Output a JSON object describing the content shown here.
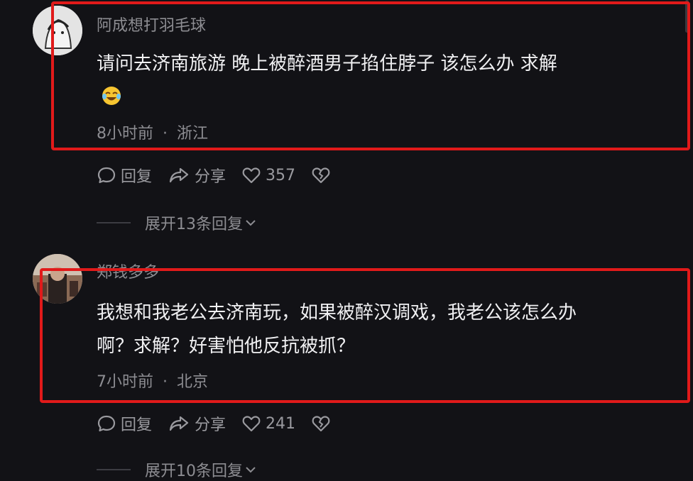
{
  "comments": [
    {
      "username": "阿成想打羽毛球",
      "text_line1": "请问去济南旅游 晚上被醉酒男子掐住脖子 该怎么办 求解",
      "emoji": "rolling-laugh-emoji",
      "time": "8小时前",
      "location": "浙江",
      "reply_label": "回复",
      "share_label": "分享",
      "likes": "357",
      "expand_label": "展开13条回复"
    },
    {
      "username": "郑钱多多",
      "text_line1": "我想和我老公去济南玩，如果被醉汉调戏，我老公该怎么办",
      "text_line2": "啊？求解？好害怕他反抗被抓？",
      "time": "7小时前",
      "location": "北京",
      "reply_label": "回复",
      "share_label": "分享",
      "likes": "241",
      "expand_label": "展开10条回复"
    }
  ],
  "separator": "·",
  "colors": {
    "background": "#121216",
    "highlight": "#e11a1a",
    "secondary_text": "#8d8d92"
  },
  "icons": [
    "comment-bubble-icon",
    "share-arrow-icon",
    "heart-icon",
    "broken-heart-icon",
    "chevron-down-icon"
  ]
}
